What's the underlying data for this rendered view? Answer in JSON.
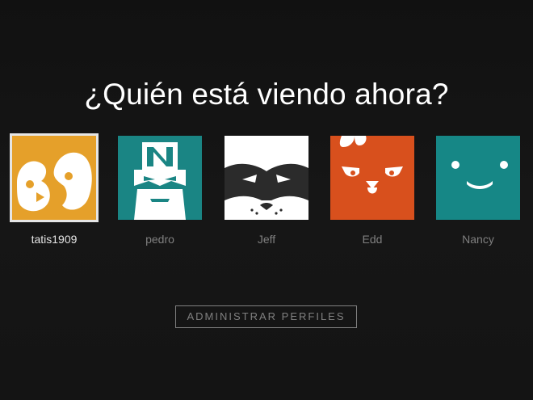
{
  "heading": "¿Quién está viendo ahora?",
  "profiles": [
    {
      "name": "tatis1909",
      "icon": "penguin-avatar-icon",
      "color": "#e5a02a",
      "active": true
    },
    {
      "name": "pedro",
      "icon": "wrestler-avatar-icon",
      "color": "#1a8584",
      "active": false
    },
    {
      "name": "Jeff",
      "icon": "raccoon-avatar-icon",
      "color": "#ffffff",
      "active": false
    },
    {
      "name": "Edd",
      "icon": "chicken-avatar-icon",
      "color": "#d8501d",
      "active": false
    },
    {
      "name": "Nancy",
      "icon": "smiley-avatar-icon",
      "color": "#168786",
      "active": false
    }
  ],
  "manage_button": "ADMINISTRAR PERFILES"
}
